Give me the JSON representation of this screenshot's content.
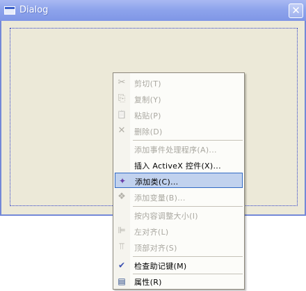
{
  "window": {
    "title": "Dialog",
    "close_glyph": "✕"
  },
  "menu": {
    "items": [
      {
        "label": "剪切(T)",
        "icon": "scissors-icon",
        "glyph": "✂",
        "enabled": false
      },
      {
        "label": "复制(Y)",
        "icon": "copy-icon",
        "glyph": "⎘",
        "enabled": false
      },
      {
        "label": "粘贴(P)",
        "icon": "paste-icon",
        "glyph": "📋",
        "enabled": false
      },
      {
        "label": "删除(D)",
        "icon": "delete-icon",
        "glyph": "✕",
        "enabled": false
      },
      {
        "label": "添加事件处理程序(A)...",
        "icon": "",
        "glyph": "",
        "enabled": false
      },
      {
        "label": "插入 ActiveX 控件(X)...",
        "icon": "",
        "glyph": "",
        "enabled": true
      },
      {
        "label": "添加类(C)...",
        "icon": "add-class-icon",
        "glyph": "✦",
        "enabled": true,
        "selected": true
      },
      {
        "label": "添加变量(B)...",
        "icon": "add-variable-icon",
        "glyph": "❖",
        "enabled": false
      },
      {
        "label": "按内容调整大小(I)",
        "icon": "",
        "glyph": "",
        "enabled": false
      },
      {
        "label": "左对齐(L)",
        "icon": "align-left-icon",
        "glyph": "⊫",
        "enabled": false
      },
      {
        "label": "顶部对齐(S)",
        "icon": "align-top-icon",
        "glyph": "⫪",
        "enabled": false
      },
      {
        "label": "检查助记键(M)",
        "icon": "check-mnemonics-icon",
        "glyph": "✔",
        "enabled": true
      },
      {
        "label": "属性(R)",
        "icon": "properties-icon",
        "glyph": "▤",
        "enabled": true
      }
    ]
  },
  "colors": {
    "titlebar": "#8ea4ec",
    "dialog_background": "#ece9d8",
    "menu_highlight": "#c1d2ee",
    "menu_highlight_border": "#316ac5",
    "disabled_text": "#a9a7a0"
  }
}
